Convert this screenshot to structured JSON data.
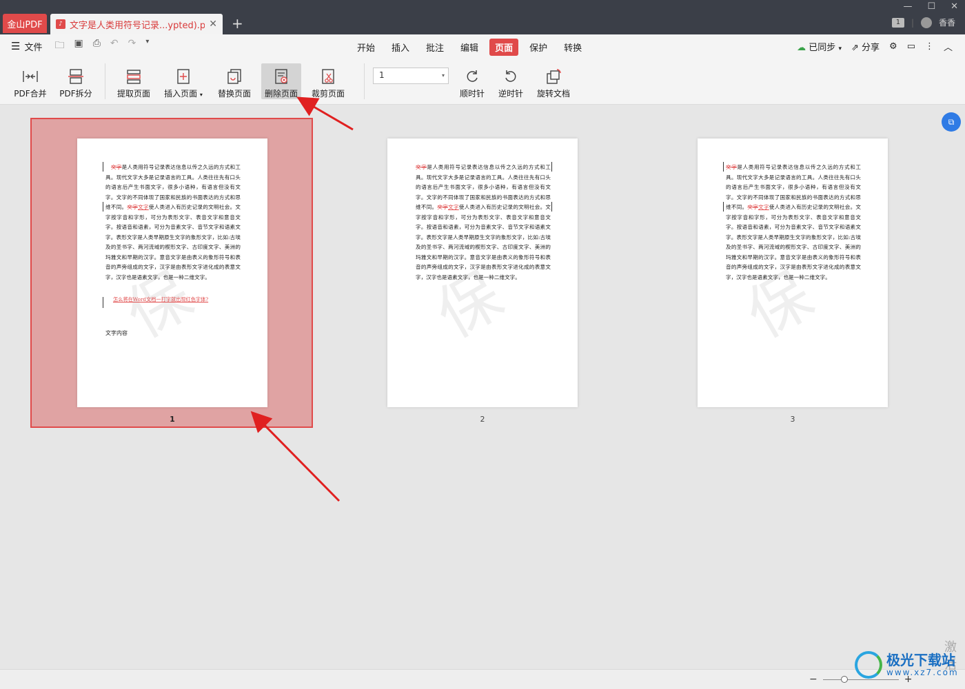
{
  "titlebar": {
    "app_tab": "金山PDF",
    "doc_tab": "文字是人类用符号记录...ypted).pdf",
    "new_tab": "+",
    "user_badge": "1",
    "user_name": "香香"
  },
  "menubar": {
    "file_label": "文件",
    "tabs": [
      "开始",
      "插入",
      "批注",
      "编辑",
      "页面",
      "保护",
      "转换"
    ],
    "active_tab": "页面",
    "sync_label": "已同步",
    "share_label": "分享"
  },
  "ribbon": {
    "buttons": [
      {
        "label": "PDF合并"
      },
      {
        "label": "PDF拆分"
      },
      {
        "label": "提取页面"
      },
      {
        "label": "插入页面"
      },
      {
        "label": "替换页面"
      },
      {
        "label": "删除页面"
      },
      {
        "label": "裁剪页面"
      },
      {
        "label": "顺时针"
      },
      {
        "label": "逆时针"
      },
      {
        "label": "旋转文档"
      }
    ],
    "page_select_value": "1"
  },
  "pages": [
    {
      "number": "1",
      "selected": true,
      "del_word": "文字",
      "text_a": "是人类用符号记录表达信息以传之久远的方式和工具。现代文字大多是记录语言的工具。人类往往先有口头的语言后产生书面文字，很多小语种，有语言但没有文字。文字的不同体现了国家和民族的书面表达的方式和思维不同。",
      "del_word2": "文字",
      "ins_word": "文字",
      "text_b": "使人类进入有历史记录的文明社会。文字按字音和字形，可分为表形文字、表音文字和意音文字。按语音和语素，可分为音素文字、音节文字和语素文字。表形文字是人类早期原生文字的象形文字，比如:古埃及的圣书字、两河流域的楔形文字、古印度文字、美洲的玛雅文和早期的汉字。意音文字是由表义的象形符号和表音的声旁组成的文字，汉字是由表形文字进化成的表意文字，汉字也是语素文字，也是一种二维文字。",
      "link": "怎么将在Word文档一打字就出现红色字体?",
      "extra": "文字内容"
    },
    {
      "number": "2",
      "selected": false,
      "del_word": "文字",
      "text_a": "是人类用符号记录表达信息以传之久远的方式和工具。现代文字大多是记录语言的工具。人类往往先有口头的语言后产生书面文字，很多小语种，有语言但没有文字。文字的不同体现了国家和民族的书面表达的方式和思维不同。",
      "del_word2": "文字",
      "ins_word": "文字",
      "text_b": "使人类进入有历史记录的文明社会。文字按字音和字形，可分为表形文字、表音文字和意音文字。按语音和语素，可分为音素文字、音节文字和语素文字。表形文字是人类早期原生文字的象形文字，比如:古埃及的圣书字、两河流域的楔形文字、古印度文字、美洲的玛雅文和早期的汉字。意音文字是由表义的象形符号和表音的声旁组成的文字，汉字是由表形文字进化成的表意文字，汉字也是语素文字，也是一种二维文字。",
      "link": "",
      "extra": ""
    },
    {
      "number": "3",
      "selected": false,
      "del_word": "文字",
      "text_a": "是人类用符号记录表达信息以传之久远的方式和工具。现代文字大多是记录语言的工具。人类往往先有口头的语言后产生书面文字，很多小语种，有语言但没有文字。文字的不同体现了国家和民族的书面表达的方式和思维不同。",
      "del_word2": "文字",
      "ins_word": "文字",
      "text_b": "使人类进入有历史记录的文明社会。文字按字音和字形，可分为表形文字、表音文字和意音文字。按语音和语素，可分为音素文字、音节文字和语素文字。表形文字是人类早期原生文字的象形文字，比如:古埃及的圣书字、两河流域的楔形文字、古印度文字、美洲的玛雅文和早期的汉字。意音文字是由表义的象形符号和表音的声旁组成的文字，汉字是由表形文字进化成的表意文字，汉字也是语素文字，也是一种二维文字。",
      "link": "",
      "extra": ""
    }
  ],
  "statusbar": {
    "zoom_out": "−",
    "zoom_in": "+"
  },
  "overlay": {
    "activate_text": "激活",
    "site_name": "极光下载站",
    "site_url": "www.xz7.com"
  },
  "colors": {
    "accent": "#e04a4a",
    "titlebar": "#3b3f48",
    "selection": "#e0a3a3",
    "arrow": "#e02020"
  }
}
